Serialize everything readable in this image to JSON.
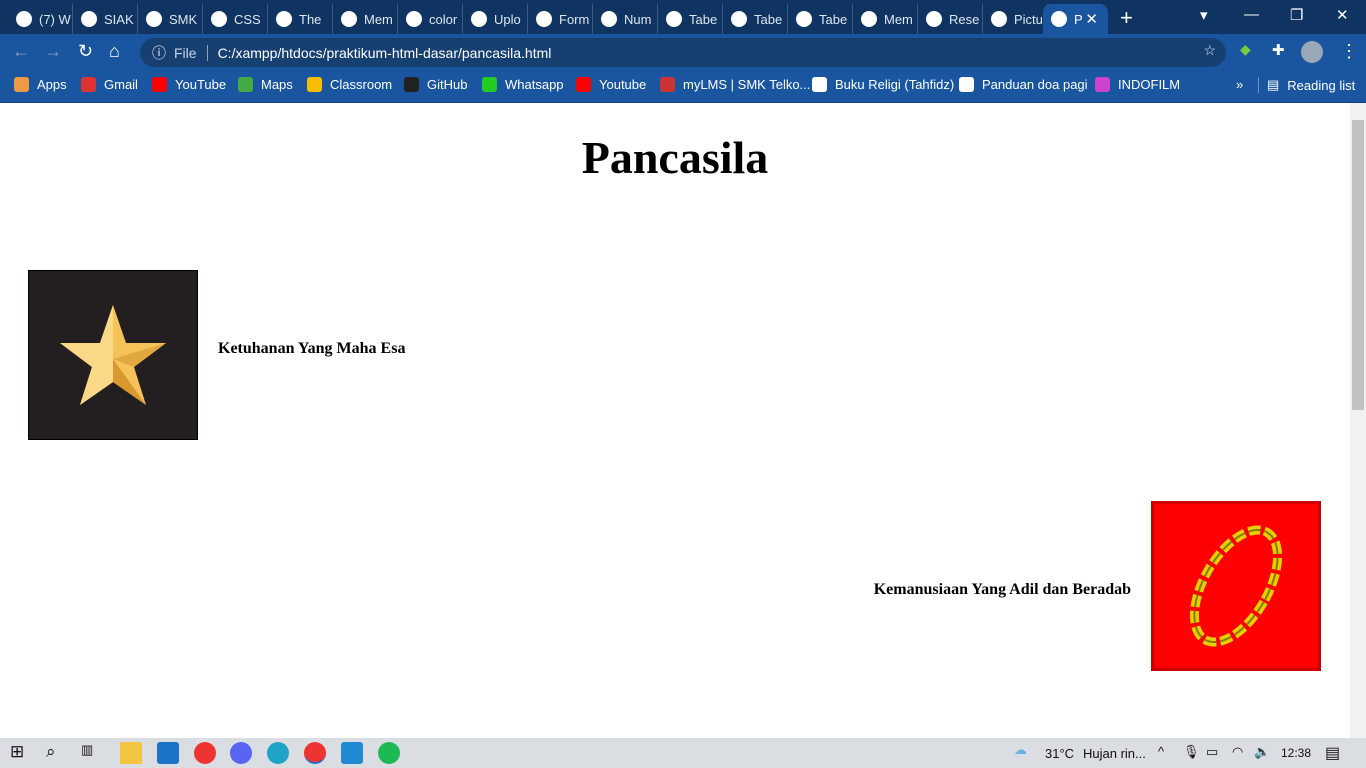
{
  "tabs": [
    "(7) W",
    "SIAK",
    "SMK",
    "CSS",
    "The",
    "Mem",
    "color",
    "Uplo",
    "Form",
    "Num",
    "Tabe",
    "Tabe",
    "Tabe",
    "Mem",
    "Rese",
    "Pictu"
  ],
  "active_tab": "P",
  "address": {
    "scheme_label": "File",
    "url": "C:/xampp/htdocs/praktikum-html-dasar/pancasila.html"
  },
  "bookmarks": [
    "Apps",
    "Gmail",
    "YouTube",
    "Maps",
    "Classroom",
    "GitHub",
    "Whatsapp",
    "Youtube",
    "myLMS | SMK Telko...",
    "Buku Religi (Tahfidz)",
    "Panduan doa pagi",
    "INDOFILM"
  ],
  "reading_list": "Reading list",
  "page": {
    "title": "Pancasila",
    "items": [
      {
        "label": "Ketuhanan Yang Maha Esa"
      },
      {
        "label": "Kemanusiaan Yang Adil dan Beradab"
      }
    ]
  },
  "taskbar": {
    "weather": "31°C",
    "weather_text": "Hujan rin...",
    "time": "12:38"
  }
}
